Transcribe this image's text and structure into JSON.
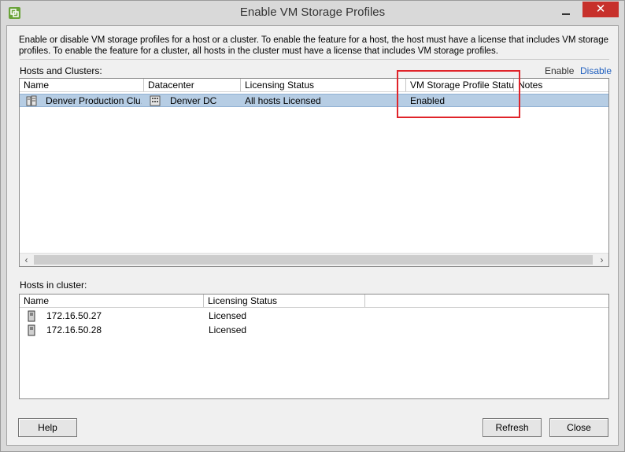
{
  "window": {
    "title": "Enable VM Storage Profiles"
  },
  "description": "Enable or disable VM storage profiles for a host or a cluster. To enable the feature for a host, the host must have a license that includes VM storage profiles. To enable the feature for a cluster, all hosts in the cluster must have a license that includes VM storage profiles.",
  "hosts_and_clusters": {
    "label": "Hosts and Clusters:",
    "enable_link": "Enable",
    "disable_link": "Disable",
    "columns": [
      "Name",
      "Datacenter",
      "Licensing Status",
      "VM Storage Profile Status",
      "Notes"
    ],
    "rows": [
      {
        "name": "Denver Production Clu...",
        "datacenter": "Denver DC",
        "licensing": "All hosts Licensed",
        "status": "Enabled",
        "notes": "",
        "icon": "cluster-icon"
      }
    ]
  },
  "hosts_in_cluster": {
    "label": "Hosts in cluster:",
    "columns": [
      "Name",
      "Licensing Status",
      ""
    ],
    "rows": [
      {
        "name": "172.16.50.27",
        "licensing": "Licensed",
        "icon": "host-icon"
      },
      {
        "name": "172.16.50.28",
        "licensing": "Licensed",
        "icon": "host-icon"
      }
    ]
  },
  "buttons": {
    "help": "Help",
    "refresh": "Refresh",
    "close": "Close"
  },
  "colors": {
    "selection": "#b6cde4",
    "highlight_box": "#e0242a",
    "link": "#1f5fbf",
    "close_button": "#c7302b"
  }
}
